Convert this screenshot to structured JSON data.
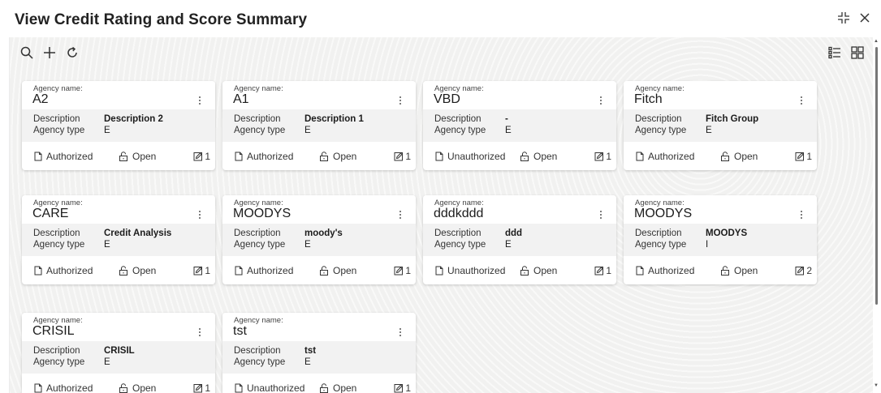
{
  "header": {
    "title": "View Credit Rating and Score Summary",
    "icons": [
      "minimize-icon",
      "close-icon"
    ]
  },
  "toolbar": {
    "icons": [
      "search-icon",
      "add-icon",
      "refresh-icon"
    ]
  },
  "view_toggle": {
    "icons": [
      "list-view-icon",
      "tile-view-icon"
    ]
  },
  "labels": {
    "agency_name": "Agency name:",
    "description": "Description",
    "agency_type": "Agency type"
  },
  "cards": [
    {
      "name": "A2",
      "description": "Description 2",
      "agency_type": "E",
      "status": "Authorized",
      "lock": "Open",
      "count": "1"
    },
    {
      "name": "A1",
      "description": "Description 1",
      "agency_type": "E",
      "status": "Authorized",
      "lock": "Open",
      "count": "1"
    },
    {
      "name": "VBD",
      "description": "-",
      "agency_type": "E",
      "status": "Unauthorized",
      "lock": "Open",
      "count": "1"
    },
    {
      "name": "Fitch",
      "description": "Fitch Group",
      "agency_type": "E",
      "status": "Authorized",
      "lock": "Open",
      "count": "1"
    },
    {
      "name": "CARE",
      "description": "Credit Analysis",
      "agency_type": "E",
      "status": "Authorized",
      "lock": "Open",
      "count": "1"
    },
    {
      "name": "MOODYS",
      "description": "moody's",
      "agency_type": "E",
      "status": "Authorized",
      "lock": "Open",
      "count": "1"
    },
    {
      "name": "dddkddd",
      "description": "ddd",
      "agency_type": "E",
      "status": "Unauthorized",
      "lock": "Open",
      "count": "1"
    },
    {
      "name": "MOODYS",
      "description": "MOODYS",
      "agency_type": "I",
      "status": "Authorized",
      "lock": "Open",
      "count": "2"
    },
    {
      "name": "CRISIL",
      "description": "CRISIL",
      "agency_type": "E",
      "status": "Authorized",
      "lock": "Open",
      "count": "1"
    },
    {
      "name": "tst",
      "description": "tst",
      "agency_type": "E",
      "status": "Unauthorized",
      "lock": "Open",
      "count": "1"
    }
  ]
}
